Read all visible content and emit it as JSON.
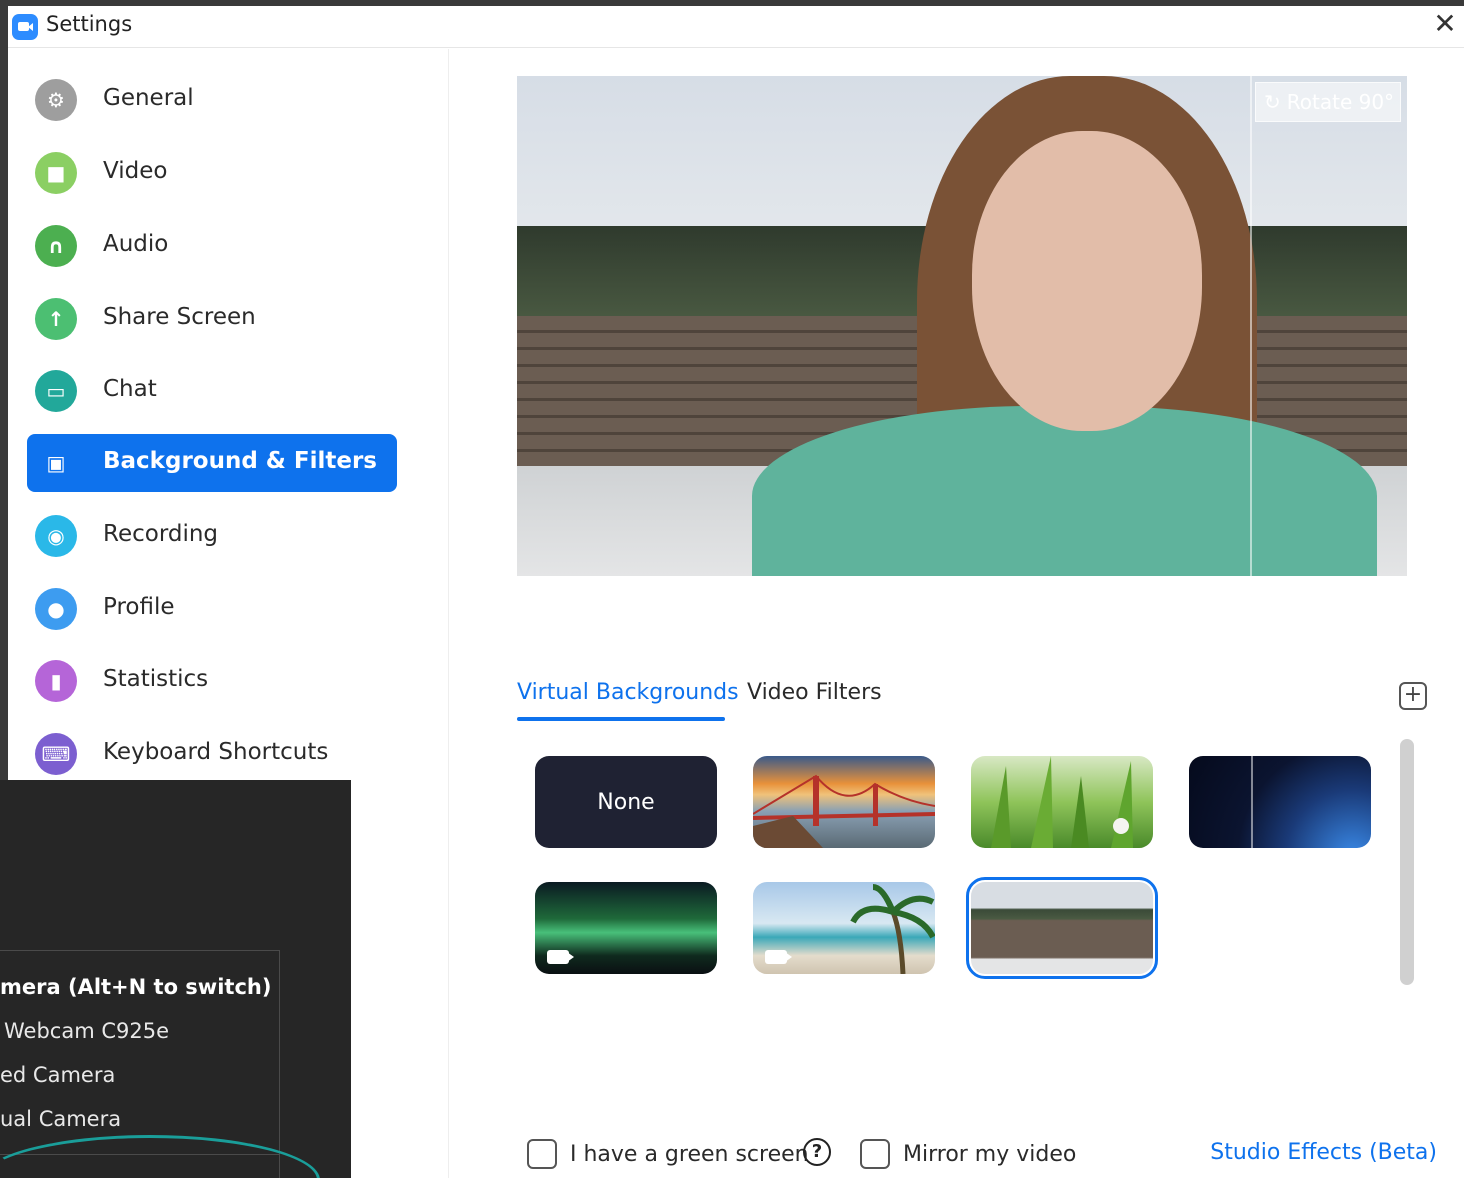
{
  "window": {
    "title": "Settings",
    "close_glyph": "✕"
  },
  "sidebar": {
    "items": [
      {
        "label": "General",
        "icon": "gear-icon",
        "color": "#9e9e9e",
        "glyph": "⚙"
      },
      {
        "label": "Video",
        "icon": "video-camera-icon",
        "color": "#8bcf63",
        "glyph": "■"
      },
      {
        "label": "Audio",
        "icon": "headphones-icon",
        "color": "#4caf50",
        "glyph": "∩"
      },
      {
        "label": "Share Screen",
        "icon": "share-screen-icon",
        "color": "#4cbf72",
        "glyph": "↑"
      },
      {
        "label": "Chat",
        "icon": "chat-bubble-icon",
        "color": "#22a89a",
        "glyph": "▭"
      },
      {
        "label": "Background & Filters",
        "icon": "background-filters-icon",
        "color": "#ffffff",
        "glyph": "▣",
        "active": true
      },
      {
        "label": "Recording",
        "icon": "recording-icon",
        "color": "#2ab8e8",
        "glyph": "◉"
      },
      {
        "label": "Profile",
        "icon": "profile-icon",
        "color": "#3d9cf0",
        "glyph": "●"
      },
      {
        "label": "Statistics",
        "icon": "statistics-icon",
        "color": "#b565d8",
        "glyph": "▮"
      },
      {
        "label": "Keyboard Shortcuts",
        "icon": "keyboard-icon",
        "color": "#7c5fd0",
        "glyph": "⌨"
      }
    ]
  },
  "overlay_menu": {
    "heading": "mera (Alt+N to switch)",
    "options": [
      "Webcam C925e",
      "ed Camera",
      "ual Camera"
    ]
  },
  "preview": {
    "rotate_label": "Rotate 90°",
    "rotate_icon": "rotate-icon",
    "rotate_glyph": "↻"
  },
  "tabs": {
    "items": [
      "Virtual Backgrounds",
      "Video Filters"
    ],
    "active": "Virtual Backgrounds",
    "add_glyph": "+"
  },
  "backgrounds": {
    "none_label": "None",
    "thumbnails": [
      {
        "kind": "none"
      },
      {
        "kind": "golden-gate-bridge"
      },
      {
        "kind": "grass"
      },
      {
        "kind": "earth-from-space"
      },
      {
        "kind": "aurora",
        "video": true
      },
      {
        "kind": "beach-palm",
        "video": true
      },
      {
        "kind": "snowy-fence",
        "selected": true
      }
    ]
  },
  "options": {
    "green_screen_label": "I have a green screen",
    "help_glyph": "?",
    "mirror_label": "Mirror my video",
    "studio_effects_label": "Studio Effects (Beta)"
  },
  "colors": {
    "accent": "#0e72ed",
    "overlay_bg": "#262626",
    "overlay_curve": "#1a9e9a"
  }
}
